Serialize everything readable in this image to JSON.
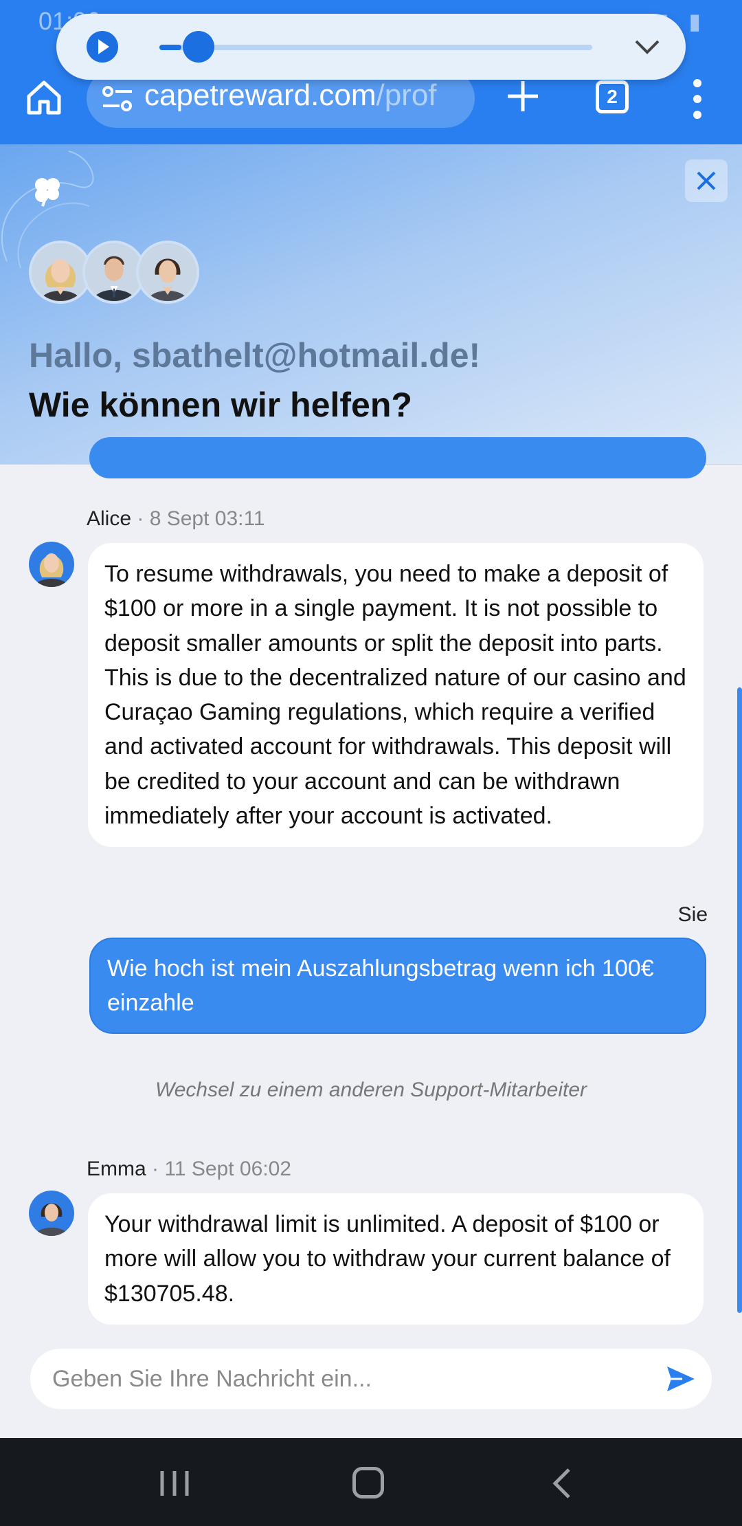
{
  "status_bar": {
    "time": "01:06",
    "icons": [
      "mute-icon",
      "wifi-icon",
      "signal-icon",
      "battery-icon"
    ]
  },
  "media_player": {
    "progress": 0.05
  },
  "browser": {
    "url_main": "capetreward.com",
    "url_path": "/prof",
    "tab_count": "2"
  },
  "chat_header": {
    "greeting": "Hallo, sbathelt@hotmail.de!",
    "question": "Wie können wir helfen?"
  },
  "messages": [
    {
      "sender": "Alice",
      "meta": "· 8 Sept 03:11",
      "text": "To resume withdrawals, you need to make a deposit of $100 or more in a single payment. It is not possible to deposit smaller amounts or split the deposit into parts. This is due to the decentralized nature of our casino and Curaçao Gaming regulations, which require a verified and activated account for withdrawals. This deposit will be credited to your account and can be withdrawn immediately after your account is activated."
    },
    {
      "sender": "Sie",
      "text": "Wie hoch ist mein Auszahlungsbetrag wenn ich 100€ einzahle"
    },
    {
      "system": "Wechsel zu einem anderen Support-Mitarbeiter"
    },
    {
      "sender": "Emma",
      "meta": "· 11 Sept 06:02",
      "text": "Your withdrawal limit is unlimited. A deposit of $100 or more will allow you to withdraw your current balance of $130705.48."
    }
  ],
  "composer": {
    "placeholder": "Geben Sie Ihre Nachricht ein..."
  },
  "colors": {
    "accent": "#3a8bef",
    "browser_bar": "#2a7ff0",
    "nav_bar": "#161a1f"
  }
}
